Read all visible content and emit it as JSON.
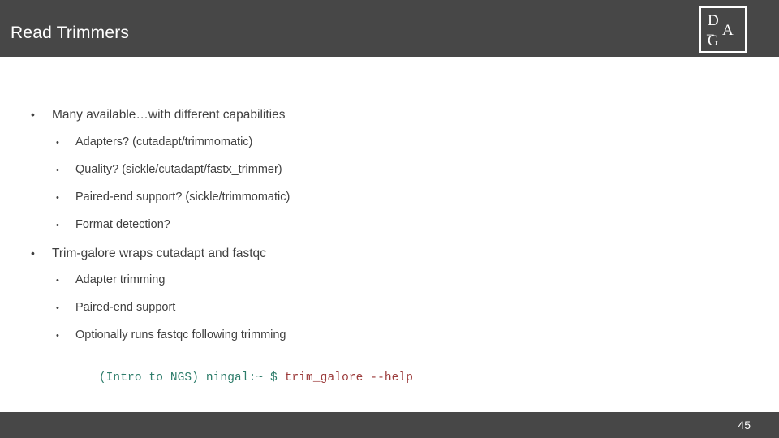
{
  "slide": {
    "title": "Read Trimmers",
    "page_number": "45",
    "header_color": "#474747",
    "footer_color": "#474747",
    "body_text_color": "#3f3f3f",
    "title_color": "#ffffff"
  },
  "logo": {
    "name": "DAG",
    "letter_d": "D",
    "letter_dash": "–",
    "letter_a": "A",
    "letter_g": "G"
  },
  "bullets": [
    {
      "level": 1,
      "marker": "•",
      "text": "Many available…with different capabilities"
    },
    {
      "level": 2,
      "marker": "•",
      "text": "Adapters? (cutadapt/trimmomatic)"
    },
    {
      "level": 2,
      "marker": "•",
      "text": "Quality? (sickle/cutadapt/fastx_trimmer)"
    },
    {
      "level": 2,
      "marker": "•",
      "text": "Paired-end support? (sickle/trimmomatic)"
    },
    {
      "level": 2,
      "marker": "•",
      "text": "Format detection?"
    },
    {
      "level": 1,
      "marker": "•",
      "text": "Trim-galore wraps cutadapt and fastqc"
    },
    {
      "level": 2,
      "marker": "•",
      "text": "Adapter trimming"
    },
    {
      "level": 2,
      "marker": "•",
      "text": "Paired-end support"
    },
    {
      "level": 2,
      "marker": "•",
      "text": "Optionally runs fastqc following trimming"
    }
  ],
  "command_line": {
    "prompt": "(Intro to NGS) ningal:~ $ ",
    "command": "trim_galore --help",
    "prompt_color": "#2e7d6b",
    "command_color": "#9c3b3b"
  }
}
